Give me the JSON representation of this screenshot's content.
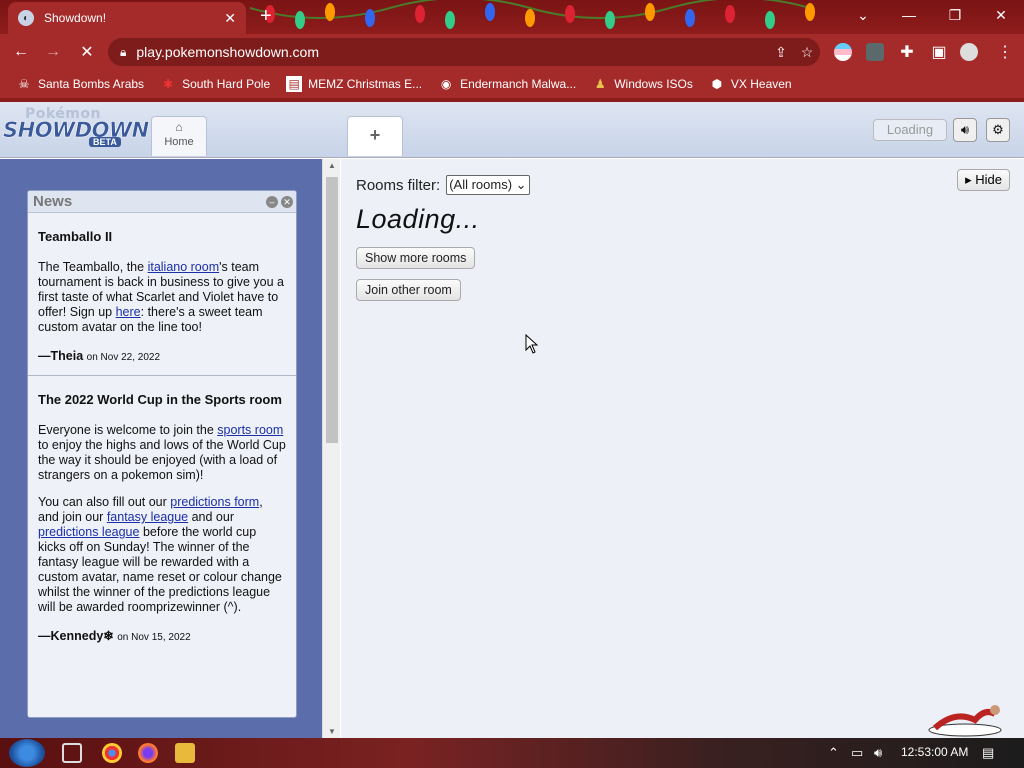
{
  "browser": {
    "tab_title": "Showdown!",
    "url": "play.pokemonshowdown.com",
    "bookmarks": [
      {
        "label": "Santa Bombs Arabs",
        "icon": "skull-icon"
      },
      {
        "label": "South Hard Pole",
        "icon": "snowflake-icon"
      },
      {
        "label": "MEMZ Christmas E...",
        "icon": "document-icon"
      },
      {
        "label": "Endermanch Malwa...",
        "icon": "raccoon-icon"
      },
      {
        "label": "Windows ISOs",
        "icon": "figure-icon"
      },
      {
        "label": "VX Heaven",
        "icon": "cube-icon"
      }
    ]
  },
  "header": {
    "logo_top": "Pokémon",
    "logo_main": "SHOWDOWN",
    "logo_badge": "BETA",
    "home_label": "Home",
    "new_tab_label": "+",
    "loading_label": "Loading"
  },
  "news": {
    "title": "News",
    "items": [
      {
        "headline": "Teamballo II",
        "p1_a": "The Teamballo, the ",
        "p1_link1": "italiano room",
        "p1_b": "'s team tournament is back in business to give you a first taste of what Scarlet and Violet have to offer! Sign up ",
        "p1_link2": "here",
        "p1_c": ": there's a sweet team custom avatar on the line too!",
        "author": "—Theia",
        "date": "on Nov 22, 2022"
      },
      {
        "headline": "The 2022 World Cup in the Sports room",
        "p1_a": "Everyone is welcome to join the ",
        "p1_link1": "sports room",
        "p1_b": " to enjoy the highs and lows of the World Cup the way it should be enjoyed (with a load of strangers on a pokemon sim)!",
        "p2_a": "You can also fill out our ",
        "p2_link1": "predictions form",
        "p2_b": ", and join our ",
        "p2_link2": "fantasy league",
        "p2_c": " and our ",
        "p2_link3": "predictions league",
        "p2_d": " before the world cup kicks off on Sunday! The winner of the fantasy league will be rewarded with a custom avatar, name reset or colour change whilst the winner of the predictions league will be awarded roomprizewinner (^).",
        "author": "—Kennedy❄",
        "date": "on Nov 15, 2022"
      }
    ]
  },
  "rooms": {
    "filter_label": "Rooms filter:",
    "filter_value": "(All rooms)",
    "loading_text": "Loading...",
    "show_more": "Show more rooms",
    "join_other": "Join other room",
    "hide": "Hide"
  },
  "taskbar": {
    "clock": "12:53:00 AM"
  },
  "colors": {
    "chrome_frame": "#a52a2a",
    "news_link": "#1a2fa8",
    "left_panel_bg": "#5b6dab"
  }
}
